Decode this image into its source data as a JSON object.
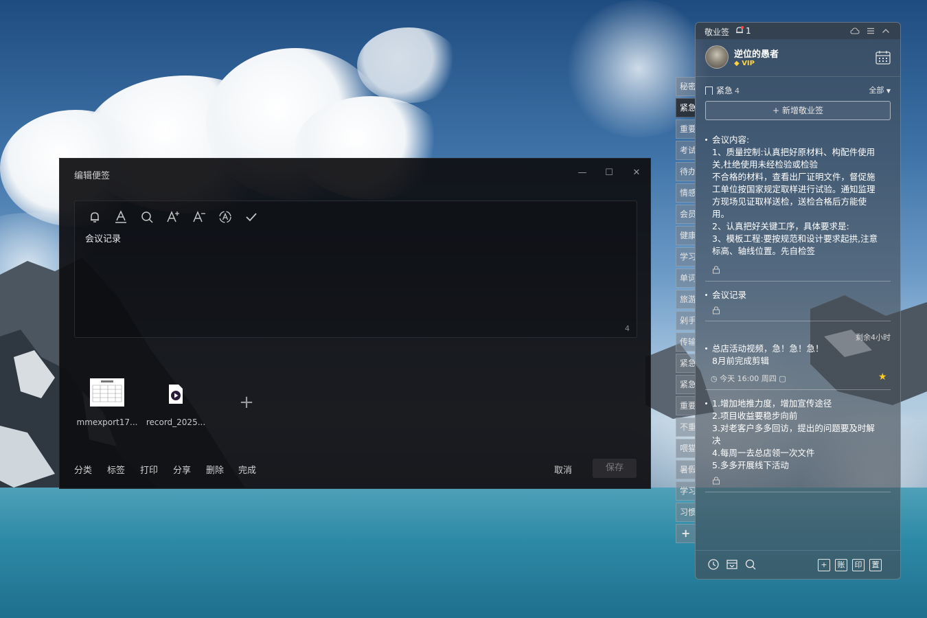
{
  "editor": {
    "title": "编辑便签",
    "content": "会议记录",
    "char_count": "4",
    "toolbar_icons": [
      "bell-icon",
      "font-color-icon",
      "search-icon",
      "font-increase-icon",
      "font-decrease-icon",
      "text-recognize-icon",
      "check-icon"
    ],
    "attachments": [
      {
        "name": "mmexport17...",
        "kind": "image"
      },
      {
        "name": "record_2025...",
        "kind": "video"
      }
    ],
    "footer": {
      "category": "分类",
      "tag": "标签",
      "print": "打印",
      "share": "分享",
      "delete": "删除",
      "done": "完成",
      "cancel": "取消",
      "save": "保存"
    }
  },
  "side_tabs": [
    "秘密",
    "紧急",
    "重要",
    "考试",
    "待办",
    "情感",
    "会员",
    "健康",
    "学习",
    "单词",
    "旅游",
    "剁手",
    "传输",
    "紧急",
    "紧急",
    "重要",
    "不重",
    "喂猫",
    "暑假",
    "学习",
    "习惯"
  ],
  "side_tabs_add": "+",
  "panel": {
    "app_name": "敬业签",
    "reminder_count": "1",
    "username": "逆位的愚者",
    "vip_label": "VIP",
    "category": "紧急",
    "category_count": "4",
    "filter": "全部",
    "add_note": "新增敬业签",
    "notes": [
      {
        "lines": [
          "会议内容:",
          "1、质量控制:认真把好原材料、构配件使用",
          "关,杜绝使用未经检验或检验",
          "不合格的材料，查看出厂证明文件，督促施",
          "工单位按国家规定取样进行试验。通知监理",
          "方现场见证取样送检，送检合格后方能使",
          "用。",
          "2、认真把好关键工序，具体要求是:",
          "3、模板工程:要按规范和设计要求起拱,注意",
          "标高、轴线位置。先自检签"
        ]
      },
      {
        "lines": [
          "会议记录"
        ]
      },
      {
        "remaining": "剩余4小时",
        "lines": [
          "总店活动视频，急！急！急！",
          "8月前完成剪辑"
        ],
        "due": "今天 16:00 周四"
      },
      {
        "lines": [
          "1.增加地推力度，增加宣传途径",
          "2.项目收益要稳步向前",
          "3.对老客户多多回访，提出的问题要及时解",
          "决",
          "4.每周一去总店领一次文件",
          "5.多多开展线下活动"
        ]
      }
    ],
    "bottom_boxes": [
      "+",
      "账",
      "印",
      "置"
    ]
  }
}
